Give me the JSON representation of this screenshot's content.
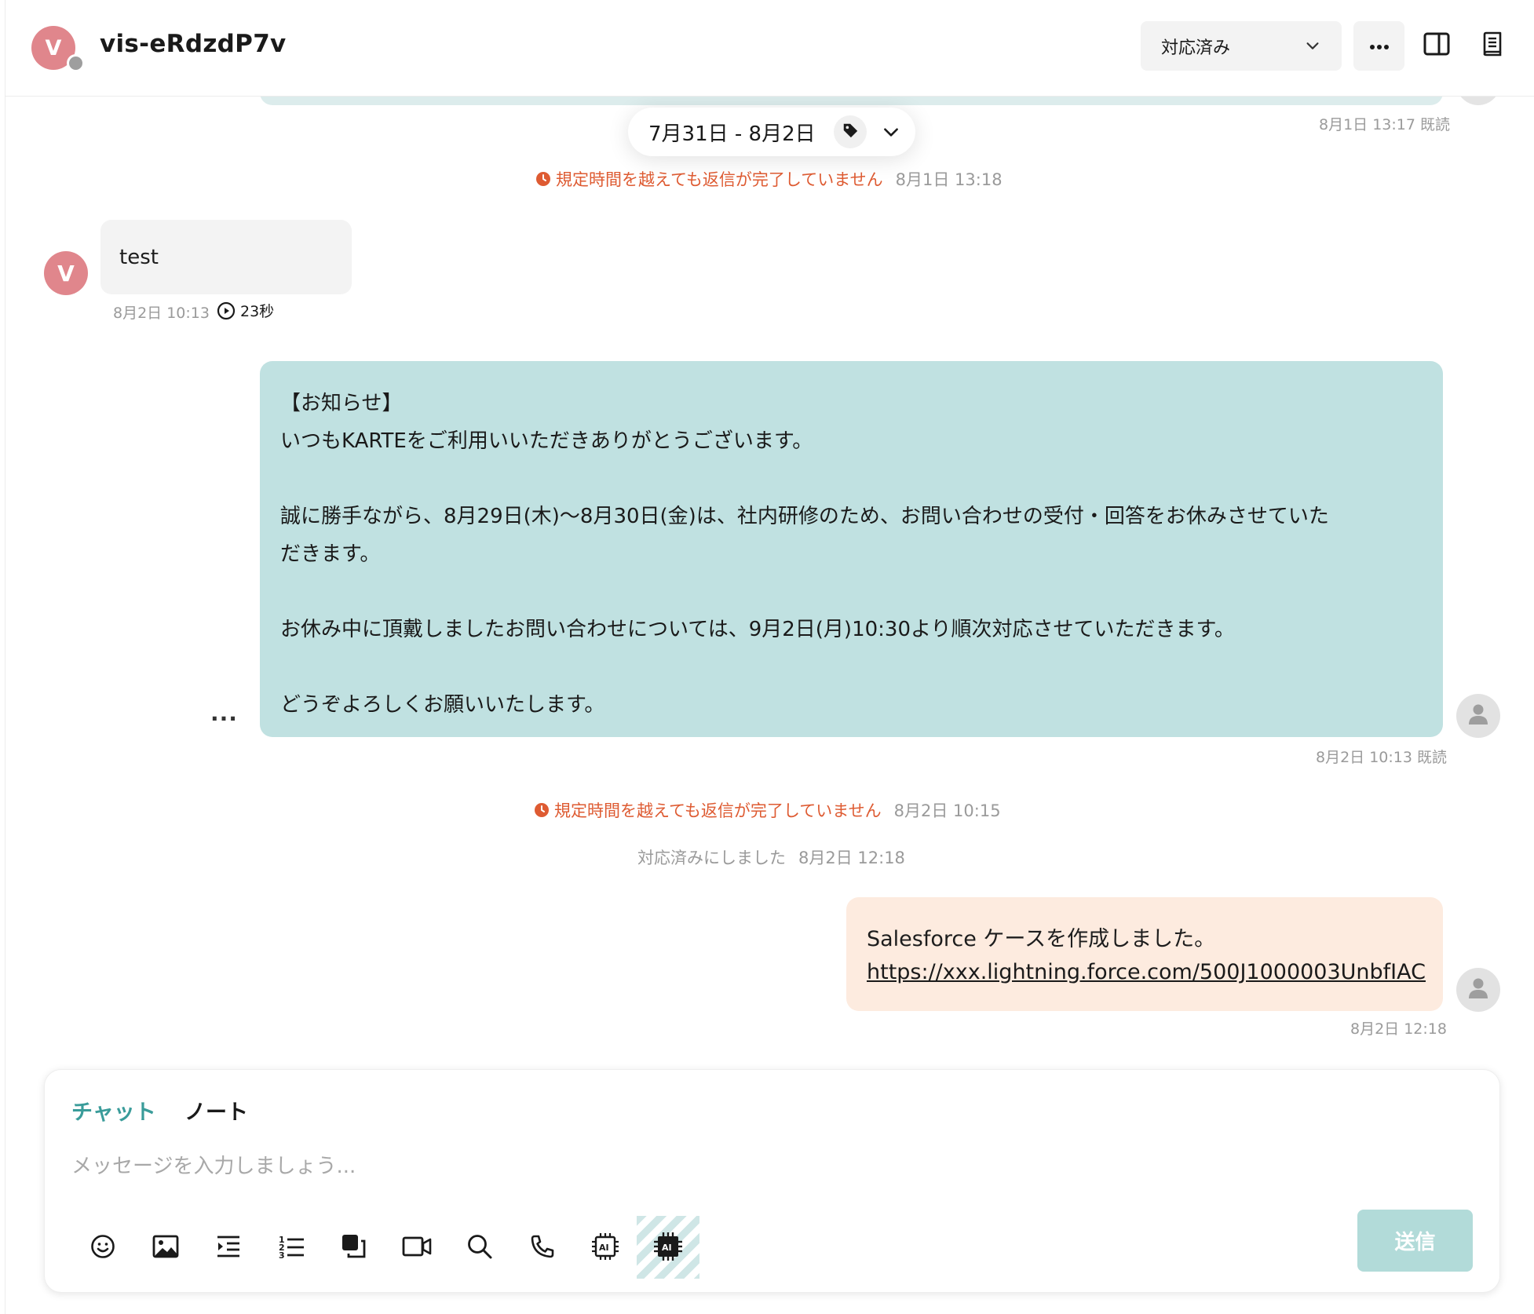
{
  "header": {
    "avatar_letter": "V",
    "title": "vis-eRdzdP7v",
    "status_value": "対応済み"
  },
  "top_meta": "8月1日 13:17 既読",
  "date_filter": {
    "label": "7月31日 - 8月2日"
  },
  "alerts": [
    {
      "text": "規定時間を越えても返信が完了していません",
      "time": "8月1日 13:18"
    },
    {
      "text": "規定時間を越えても返信が完了していません",
      "time": "8月2日 10:15"
    }
  ],
  "messages": {
    "incoming": {
      "avatar_letter": "V",
      "text": "test",
      "time": "8月2日 10:13",
      "duration": "23秒"
    },
    "announcement": {
      "text": "【お知らせ】\nいつもKARTEをご利用いいただきありがとうございます。\n\n誠に勝手ながら、8月29日(木)〜8月30日(金)は、社内研修のため、お問い合わせの受付・回答をお休みさせていた\nだきます。\n\nお休み中に頂戴しましたお問い合わせについては、9月2日(月)10:30より順次対応させていただきます。\n\nどうぞよろしくお願いいたします。",
      "meta": "8月2日 10:13 既読",
      "more_label": "..."
    },
    "system": {
      "text": "対応済みにしました",
      "time": "8月2日 12:18"
    },
    "salesforce": {
      "line1": "Salesforce ケースを作成しました。",
      "link": "https://xxx.lightning.force.com/500J1000003UnbfIAC",
      "meta": "8月2日 12:18"
    }
  },
  "composer": {
    "tabs": [
      {
        "label": "チャット",
        "active": true
      },
      {
        "label": "ノート",
        "active": false
      }
    ],
    "placeholder": "メッセージを入力しましょう...",
    "send_label": "送信",
    "tools": [
      "emoji-icon",
      "image-icon",
      "indent-icon",
      "numbered-list-icon",
      "copy-icon",
      "video-icon",
      "search-icon",
      "phone-icon",
      "ai-chip-icon",
      "ai-chip-filled-icon"
    ]
  },
  "colors": {
    "accent": "#3a9c9a",
    "avatar": "#e0868c",
    "warning": "#de5b32",
    "agent_bubble": "#c0e1e1",
    "salesforce_bubble": "#fdebdf",
    "send_button": "#b2dbd9"
  }
}
